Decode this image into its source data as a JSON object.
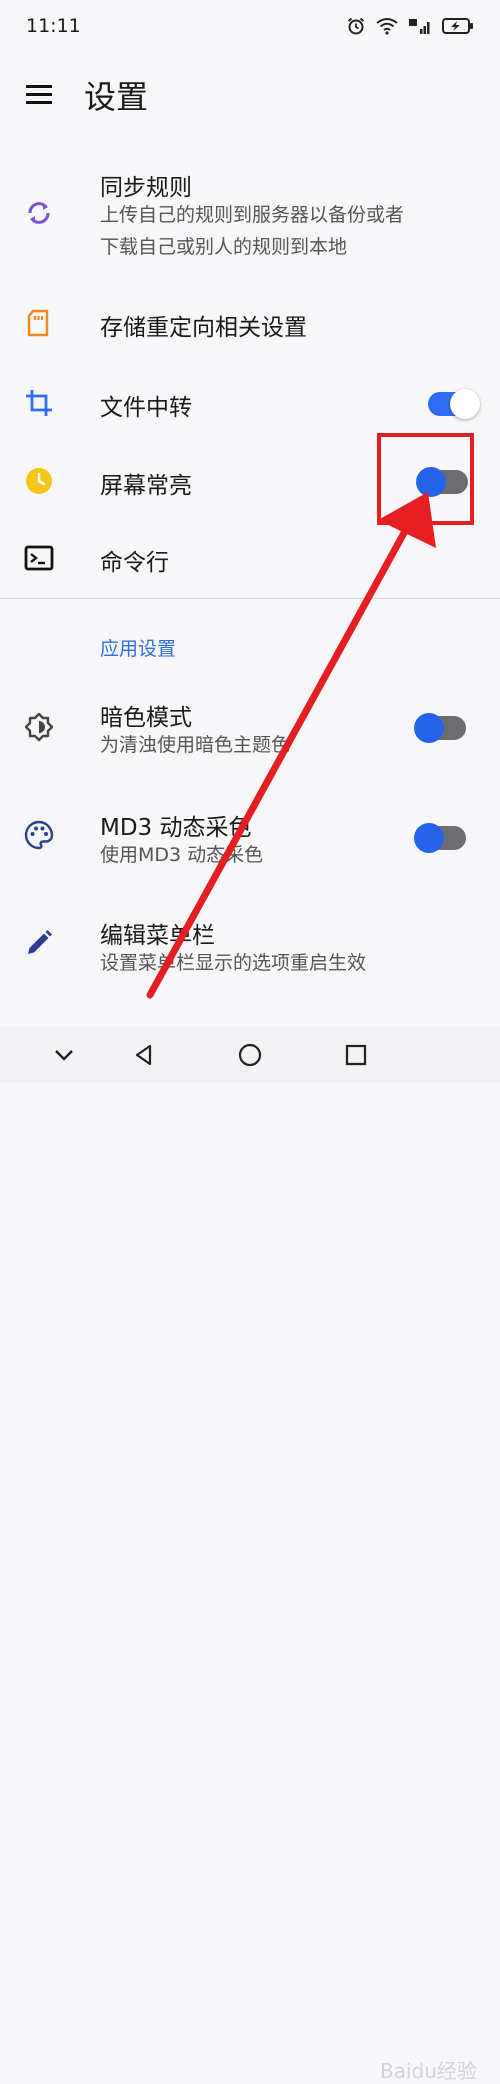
{
  "status_bar": {
    "time": "11:11"
  },
  "app_bar": {
    "title": "设置"
  },
  "items": [
    {
      "title": "同步规则",
      "sub1": "上传自己的规则到服务器以备份或者",
      "sub2": "下载自己或别人的规则到本地",
      "icon": "sync-icon"
    },
    {
      "title": "存储重定向相关设置",
      "icon": "sd-card-icon"
    },
    {
      "title": "文件中转",
      "icon": "crop-icon",
      "switch": true
    },
    {
      "title": "屏幕常亮",
      "icon": "clock-icon",
      "switch": false
    },
    {
      "title": "命令行",
      "icon": "terminal-icon"
    }
  ],
  "section_header": "应用设置",
  "app_items": [
    {
      "title": "暗色模式",
      "sub": "为清浊使用暗色主题色",
      "icon": "brightness-icon",
      "switch": false
    },
    {
      "title": "MD3 动态采色",
      "sub": "使用MD3 动态采色",
      "icon": "palette-icon",
      "switch": false
    },
    {
      "title": "编辑菜单栏",
      "sub": "设置菜单栏显示的选项重启生效",
      "icon": "pencil-icon"
    }
  ],
  "colors": {
    "accent": "#2e6cf6",
    "section": "#2f6fe0",
    "annotation": "#e51e24"
  },
  "watermark": "Baidu经验"
}
